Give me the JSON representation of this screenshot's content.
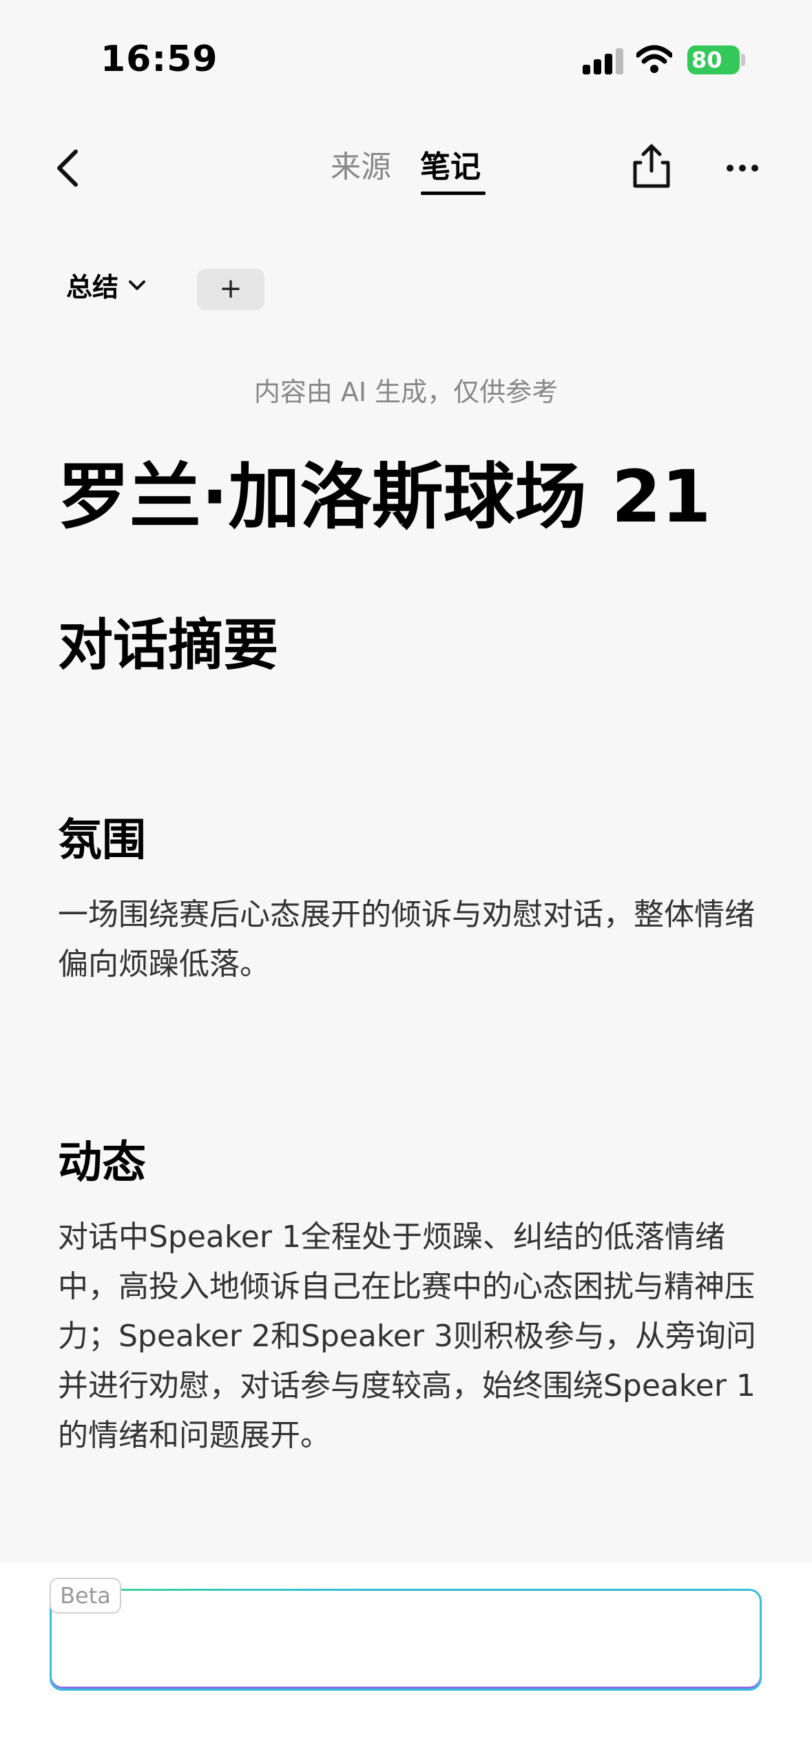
{
  "status_bar": {
    "time": "16:59",
    "battery": "80"
  },
  "nav": {
    "tabs": [
      "来源",
      "笔记"
    ],
    "active_tab": "笔记",
    "icons": [
      "chevron-left-icon",
      "share-icon",
      "more-icon"
    ]
  },
  "toolbar": {
    "summary_label": "总结",
    "add_label": "+"
  },
  "content": {
    "ai_notice": "内容由 AI 生成，仅供参考",
    "title": "罗兰·加洛斯球场 21",
    "section_title": "对话摘要",
    "sections": [
      {
        "heading": "氛围",
        "text": "一场围绕赛后心态展开的倾诉与劝慰对话，整体情绪偏向烦躁低落。"
      },
      {
        "heading": "动态",
        "text": "对话中Speaker 1全程处于烦躁、纠结的低落情绪中，高投入地倾诉自己在比赛中的心态困扰与精神压力；Speaker 2和Speaker 3则积极参与，从旁询问并进行劝慰，对话参与度较高，始终围绕Speaker 1的情绪和问题展开。"
      }
    ]
  },
  "input": {
    "badge": "Beta"
  },
  "colors": {
    "battery": "#34c759",
    "input_border": "#33bde0",
    "input_gradient_start": "#3fd68c",
    "input_gradient_end": "#8a6be8"
  }
}
